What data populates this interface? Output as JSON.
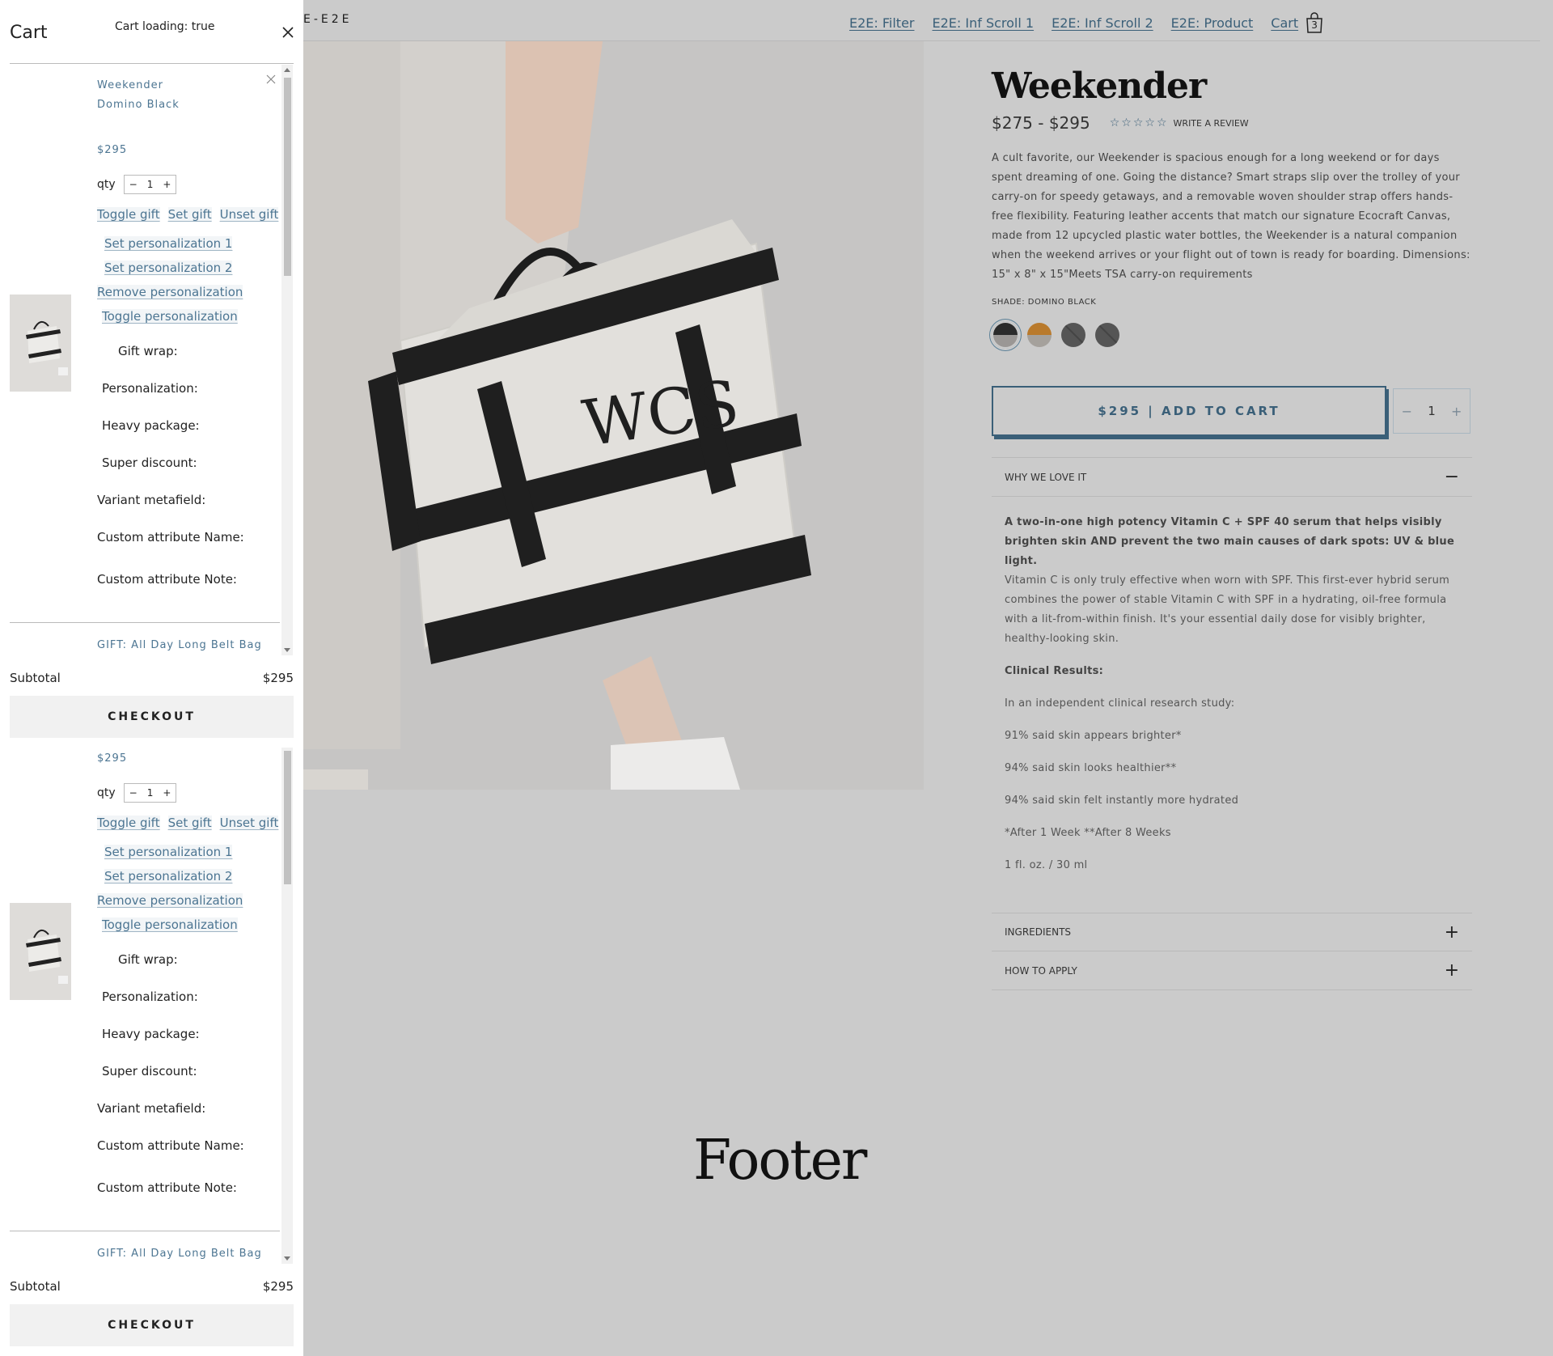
{
  "site": {
    "brand": "E-E2E",
    "nav": [
      "E2E: Filter",
      "E2E: Inf Scroll 1",
      "E2E: Inf Scroll 2",
      "E2E: Product",
      "Cart"
    ],
    "cart_count": "3"
  },
  "product": {
    "title": "Weekender",
    "price_range": "$275 - $295",
    "review_link": "WRITE A REVIEW",
    "rating_stars": 0,
    "description": "A cult favorite, our Weekender is spacious enough for a long weekend or for days spent dreaming of one. Going the distance? Smart straps slip over the trolley of your carry-on for speedy getaways, and a removable woven shoulder strap offers hands-free flexibility. Featuring leather accents that match our signature Ecocraft Canvas, made from 12 upcycled plastic water bottles, the Weekender is a natural companion when the weekend arrives or your flight out of town is ready for boarding. Dimensions: 15\" x 8\" x 15\"Meets TSA carry-on requirements",
    "shade_label": "SHADE: DOMINO BLACK",
    "swatch_colors": [
      "#2b2b2b",
      "#b97a2c",
      "#555555",
      "#555555"
    ],
    "add_to_cart": "$295 | ADD TO CART",
    "quantity": "1",
    "accent_color": "#3a5f78"
  },
  "accordion": {
    "why_title": "WHY WE LOVE IT",
    "why_lead": "A two-in-one high potency Vitamin C + SPF 40 serum that helps visibly brighten skin AND prevent the two main causes of dark spots: UV & blue light.",
    "why_body": "Vitamin C is only truly effective when worn with SPF. This first-ever hybrid serum combines the power of stable Vitamin C with SPF in a hydrating, oil-free formula with a lit-from-within finish. It's your essential daily dose for visibly brighter, healthy-looking skin.",
    "clinical_title": "Clinical Results:",
    "clinical_intro": "In an independent clinical research study:",
    "stat1": "91% said skin appears brighter*",
    "stat2": "94% said skin looks healthier**",
    "stat3": "94% said skin felt instantly more hydrated",
    "footnote": "*After 1 Week **After 8 Weeks",
    "size": "1 fl. oz. / 30 ml",
    "ingredients_title": "INGREDIENTS",
    "how_title": "HOW TO APPLY"
  },
  "footer": {
    "title": "Footer"
  },
  "cart": {
    "title": "Cart",
    "loading": "Cart loading: true",
    "item_name": "Weekender",
    "item_variant": "Domino Black",
    "item_price": "$295",
    "qty_label": "qty",
    "qty_value": "1",
    "toggle_gift": "Toggle gift",
    "set_gift": "Set gift",
    "unset_gift": "Unset gift",
    "set_pers_1": "Set personalization 1",
    "set_pers_2": "Set personalization 2",
    "remove_pers": "Remove personalization",
    "toggle_pers": "Toggle personalization",
    "gift_wrap": "Gift wrap:",
    "personalization": "Personalization:",
    "heavy_package": "Heavy package:",
    "super_discount": "Super discount:",
    "variant_metafield": "Variant metafield:",
    "custom_name": "Custom attribute Name:",
    "custom_note": "Custom attribute Note:",
    "gift_item": "GIFT: All Day Long Belt Bag",
    "subtotal_label": "Subtotal",
    "subtotal_value": "$295",
    "checkout": "CHECKOUT"
  }
}
